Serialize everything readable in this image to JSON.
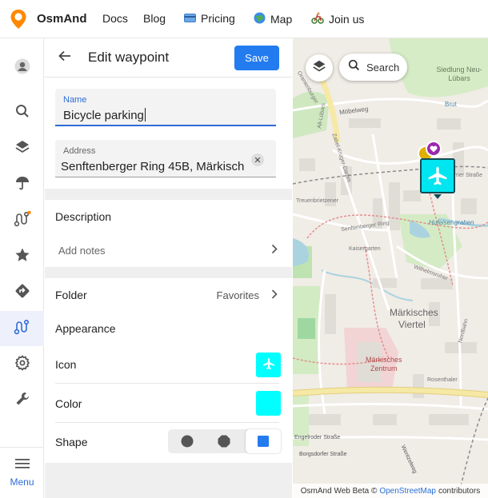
{
  "nav": {
    "brand": "OsmAnd",
    "links": [
      "Docs",
      "Blog",
      "Pricing",
      "Map",
      "Join us"
    ]
  },
  "rail": {
    "items": [
      "avatar-icon",
      "search-icon",
      "layers-icon",
      "weather-umbrella-icon",
      "route-icon",
      "favorites-star-icon",
      "navigation-icon",
      "tracks-icon",
      "settings-gear-icon",
      "tools-wrench-icon"
    ],
    "menu_label": "Menu"
  },
  "panel": {
    "title": "Edit waypoint",
    "save_label": "Save",
    "name_label": "Name",
    "name_value": "Bicycle parking",
    "address_label": "Address",
    "address_value": "Senftenberger Ring 45B, Märkisch",
    "description_title": "Description",
    "add_notes": "Add notes",
    "folder_label": "Folder",
    "folder_value": "Favorites",
    "appearance_title": "Appearance",
    "icon_label": "Icon",
    "color_label": "Color",
    "shape_label": "Shape",
    "selected_color": "#00ffff",
    "shape_options": [
      "circle",
      "octagon",
      "square"
    ],
    "selected_shape": "square"
  },
  "map": {
    "search_label": "Search",
    "labels": [
      "Siedlung Neu-Lübars",
      "Möbelweg",
      "Brut",
      "Hufeisengraben",
      "Märkisches",
      "Viertel",
      "Märkisches",
      "Zentrum",
      "Zabel-Krüger-Damm",
      "Senftenberger Ring",
      "Treuenbrietzener",
      "Wilhelmsruher",
      "Quickborner Straße",
      "Alt-Lübars",
      "Nordbahn",
      "Oranienburger",
      "Kaisergarten",
      "Rosenthaler",
      "Engelroder Straße",
      "Borgsdorfer Straße",
      "Wentzelweg"
    ],
    "attribution_prefix": "OsmAnd Web Beta ©",
    "attribution_link": "OpenStreetMap",
    "attribution_suffix": "contributors"
  }
}
